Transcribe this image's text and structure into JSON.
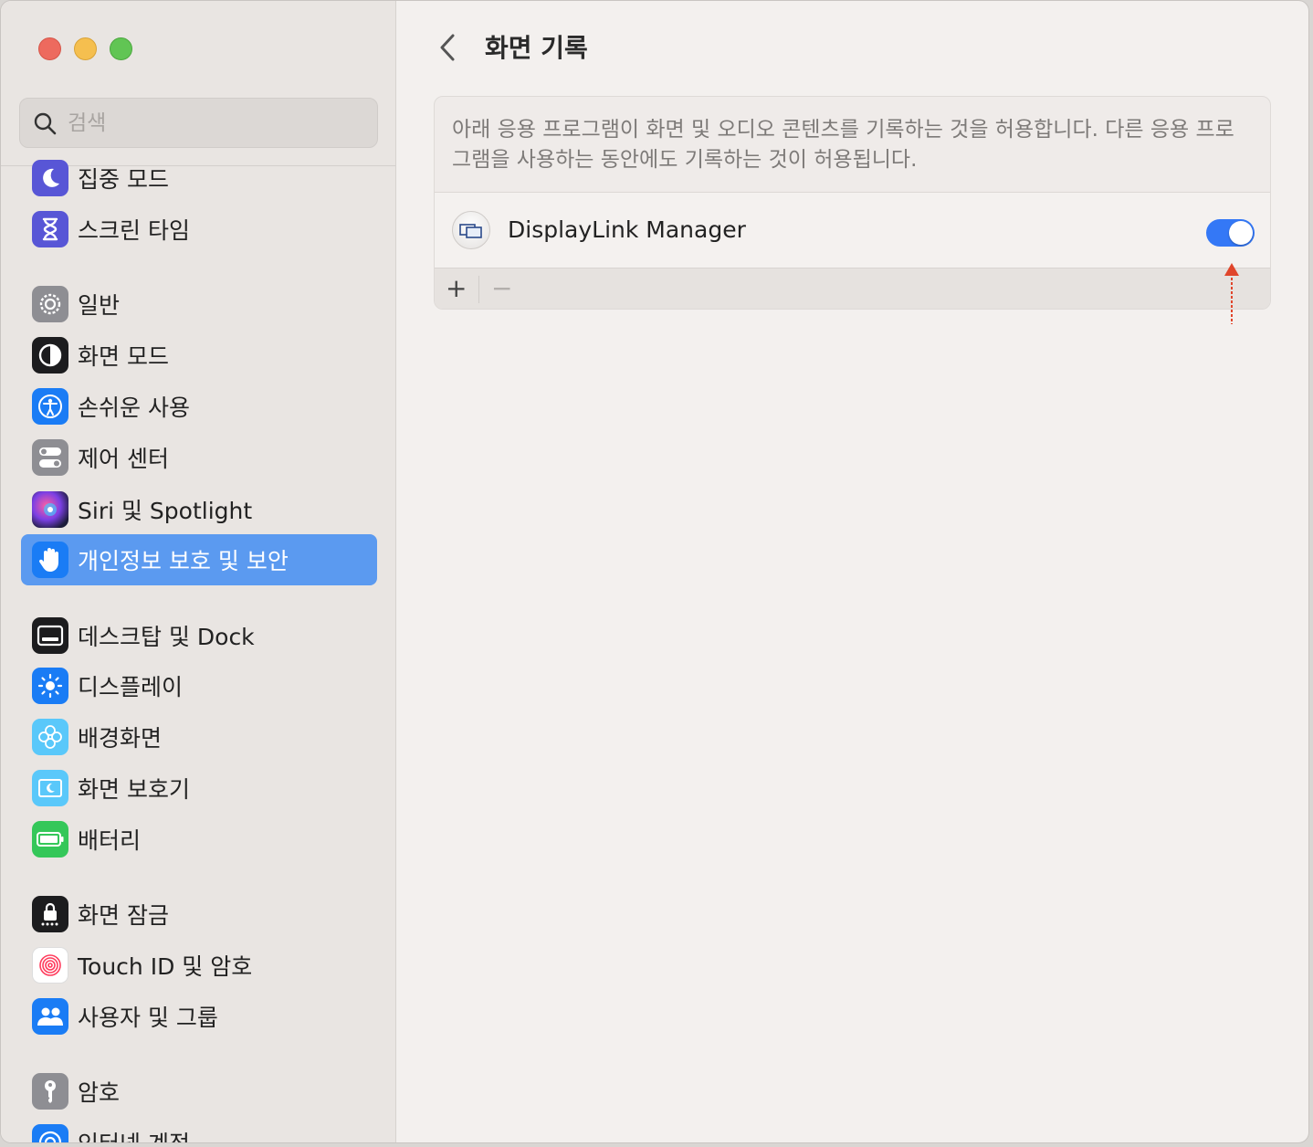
{
  "window": {
    "title": "화면 기록"
  },
  "search": {
    "placeholder": "검색"
  },
  "sidebar": {
    "items": [
      {
        "label": "집중 모드",
        "icon": "moon-icon",
        "color": "#5856d6"
      },
      {
        "label": "스크린 타임",
        "icon": "hourglass-icon",
        "color": "#5856d6"
      },
      {
        "label": "일반",
        "icon": "gear-icon",
        "color": "#8e8e93"
      },
      {
        "label": "화면 모드",
        "icon": "appearance-icon",
        "color": "#1c1c1e"
      },
      {
        "label": "손쉬운 사용",
        "icon": "accessibility-icon",
        "color": "#1a7cf5"
      },
      {
        "label": "제어 센터",
        "icon": "control-center-icon",
        "color": "#8e8e93"
      },
      {
        "label": "Siri 및 Spotlight",
        "icon": "siri-icon",
        "color": "#7b3fe4"
      },
      {
        "label": "개인정보 보호 및 보안",
        "icon": "hand-icon",
        "color": "#1a7cf5",
        "active": true
      },
      {
        "label": "데스크탑 및 Dock",
        "icon": "dock-icon",
        "color": "#1c1c1e"
      },
      {
        "label": "디스플레이",
        "icon": "sun-icon",
        "color": "#1a7cf5"
      },
      {
        "label": "배경화면",
        "icon": "flower-icon",
        "color": "#5ac8fa"
      },
      {
        "label": "화면 보호기",
        "icon": "screensaver-icon",
        "color": "#5ac8fa"
      },
      {
        "label": "배터리",
        "icon": "battery-icon",
        "color": "#34c759"
      },
      {
        "label": "화면 잠금",
        "icon": "lock-icon",
        "color": "#1c1c1e"
      },
      {
        "label": "Touch ID 및 암호",
        "icon": "fingerprint-icon",
        "color": "#ffffff"
      },
      {
        "label": "사용자 및 그룹",
        "icon": "users-icon",
        "color": "#1a7cf5"
      },
      {
        "label": "암호",
        "icon": "key-icon",
        "color": "#8e8e93"
      },
      {
        "label": "인터넷 계정",
        "icon": "at-icon",
        "color": "#1a7cf5"
      }
    ]
  },
  "main": {
    "description": "아래 응용 프로그램이 화면 및 오디오 콘텐츠를 기록하는 것을 허용합니다. 다른 응용 프로그램을 사용하는 동안에도 기록하는 것이 허용됩니다.",
    "apps": [
      {
        "name": "DisplayLink Manager",
        "enabled": true
      }
    ],
    "add_label": "+",
    "remove_label": "−"
  },
  "colors": {
    "accent": "#3478f6",
    "sidebar_selected": "#5b9af0",
    "annotation_arrow": "#e0452b"
  }
}
